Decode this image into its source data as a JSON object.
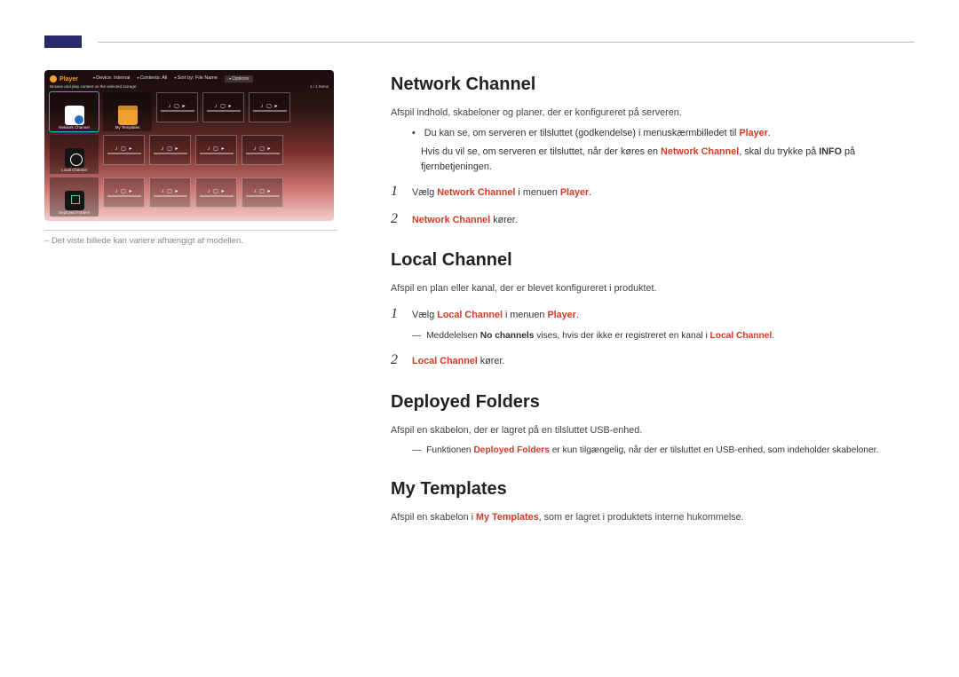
{
  "player_ui": {
    "title": "Player",
    "menu": {
      "device": "Device: Internal",
      "contents": "Contents: All",
      "sort": "Sort by: File Name",
      "options": "Options"
    },
    "subtitle_left": "Browse and play content on the selected storage",
    "subtitle_right": "1 / 1 Items",
    "big_tiles": {
      "network": "Network Channel",
      "templates": "My Templates",
      "local": "Local Channel",
      "deployed": "Deployed Folders"
    },
    "small_tile_bar": "———"
  },
  "caption": "Det viste billede kan variere afhængigt af modellen.",
  "s1": {
    "title": "Network Channel",
    "desc": "Afspil indhold, skabeloner og planer, der er konfigureret på serveren.",
    "b1a": "Du kan se, om serveren er tilsluttet (godkendelse) i menuskærmbilledet til ",
    "b1_hl": "Player",
    "b1b": ".",
    "b2a": "Hvis du vil se, om serveren er tilsluttet, når der køres en ",
    "b2_hl1": "Network Channel",
    "b2b": ", skal du trykke på ",
    "b2_k": "INFO",
    "b2c": " på fjernbetjeningen.",
    "step1_a": "Vælg ",
    "step1_hl1": "Network Channel",
    "step1_b": " i menuen ",
    "step1_hl2": "Player",
    "step1_c": ".",
    "step2_hl": "Network Channel",
    "step2_b": " kører."
  },
  "s2": {
    "title": "Local Channel",
    "desc": "Afspil en plan eller kanal, der er blevet konfigureret i produktet.",
    "step1_a": "Vælg ",
    "step1_hl1": "Local Channel",
    "step1_b": " i menuen ",
    "step1_hl2": "Player",
    "step1_c": ".",
    "note_a": "Meddelelsen ",
    "note_k": "No channels",
    "note_b": " vises, hvis der ikke er registreret en kanal i ",
    "note_hl": "Local Channel",
    "note_c": ".",
    "step2_hl": "Local Channel",
    "step2_b": " kører."
  },
  "s3": {
    "title": "Deployed Folders",
    "desc": "Afspil en skabelon, der er lagret på en tilsluttet USB-enhed.",
    "note_a": "Funktionen ",
    "note_hl": "Deployed Folders",
    "note_b": " er kun tilgængelig, når der er tilsluttet en USB-enhed, som indeholder skabeloner."
  },
  "s4": {
    "title": "My Templates",
    "desc_a": "Afspil en skabelon i ",
    "desc_hl": "My Templates",
    "desc_b": ", som er lagret i produktets interne hukommelse."
  }
}
